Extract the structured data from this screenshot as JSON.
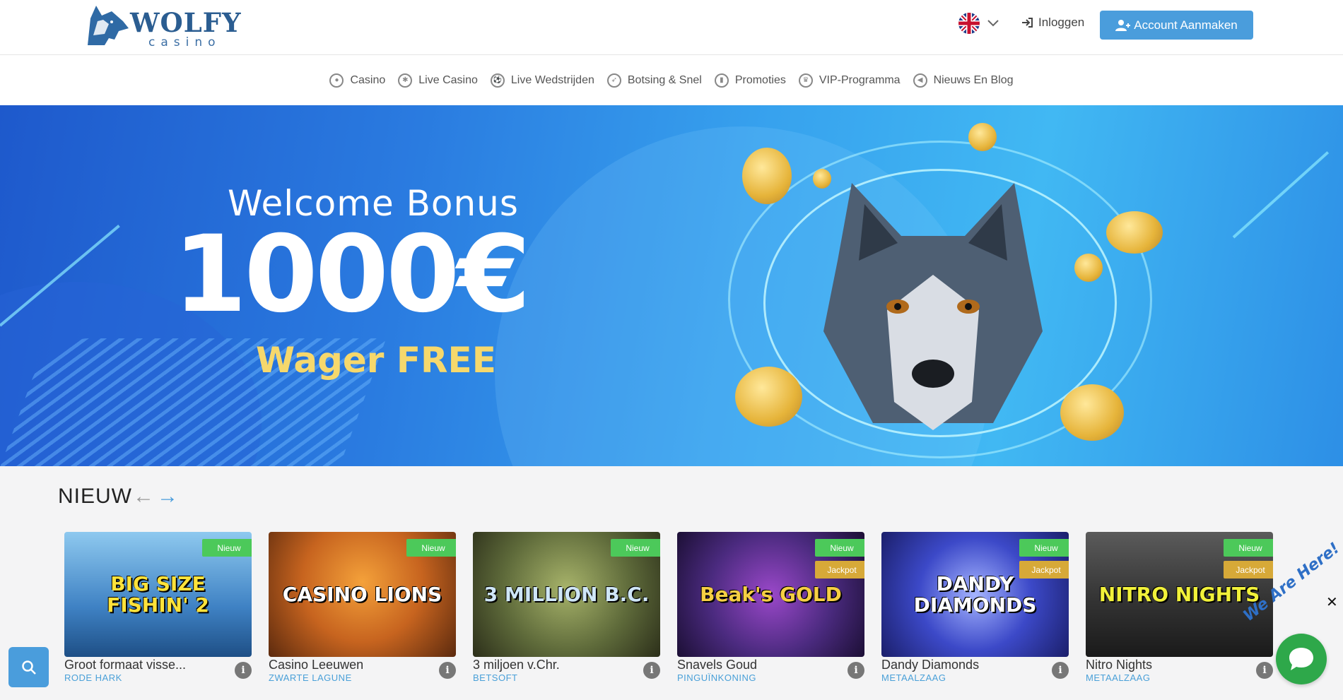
{
  "header": {
    "logo_word": "WOLFY",
    "logo_sub": "casino",
    "language_icon": "uk-flag-icon",
    "login_label": "Inloggen",
    "register_label": "Account Aanmaken"
  },
  "nav": {
    "items": [
      {
        "label": "Casino",
        "icon": "casino-chip-icon"
      },
      {
        "label": "Live Casino",
        "icon": "live-casino-icon"
      },
      {
        "label": "Live Wedstrijden",
        "icon": "live-matches-icon"
      },
      {
        "label": "Botsing & Snel",
        "icon": "rocket-icon"
      },
      {
        "label": "Promoties",
        "icon": "gift-icon"
      },
      {
        "label": "VIP-Programma",
        "icon": "crown-icon"
      },
      {
        "label": "Nieuws En Blog",
        "icon": "megaphone-icon"
      }
    ]
  },
  "hero": {
    "line1": "Welcome Bonus",
    "line2": "1000€",
    "line3": "Wager FREE"
  },
  "new_games": {
    "title": "NIEUW",
    "games": [
      {
        "thumb_title": "BIG SIZE FISHIN' 2",
        "name": "Groot formaat visse...",
        "provider": "RODE HARK",
        "badges": [
          "Nieuw"
        ],
        "bg": "#3f82c4"
      },
      {
        "thumb_title": "CASINO LIONS",
        "name": "Casino Leeuwen",
        "provider": "ZWARTE LAGUNE",
        "badges": [
          "Nieuw"
        ],
        "bg": "#c7641f"
      },
      {
        "thumb_title": "3 MILLION B.C.",
        "name": "3 miljoen v.Chr.",
        "provider": "BETSOFT",
        "badges": [
          "Nieuw"
        ],
        "bg": "#5e6a3a"
      },
      {
        "thumb_title": "Beak's GOLD",
        "name": "Snavels Goud",
        "provider": "PINGUÏNKONING",
        "badges": [
          "Nieuw",
          "Jackpot"
        ],
        "bg": "#4a2a7e"
      },
      {
        "thumb_title": "DANDY DIAMONDS",
        "name": "Dandy Diamonds",
        "provider": "METAALZAAG",
        "badges": [
          "Nieuw",
          "Jackpot"
        ],
        "bg": "#3c49c8"
      },
      {
        "thumb_title": "NITRO NIGHTS",
        "name": "Nitro Nights",
        "provider": "METAALZAAG",
        "badges": [
          "Nieuw",
          "Jackpot"
        ],
        "bg": "#333333"
      }
    ]
  },
  "chat": {
    "label": "We Are Here!",
    "close": "✕"
  },
  "colors": {
    "primary": "#4a9ddc",
    "new_badge": "#4cc95a",
    "jackpot_badge": "#d7a938",
    "provider_text": "#4aa0d8",
    "chat_green": "#2ea84a"
  }
}
